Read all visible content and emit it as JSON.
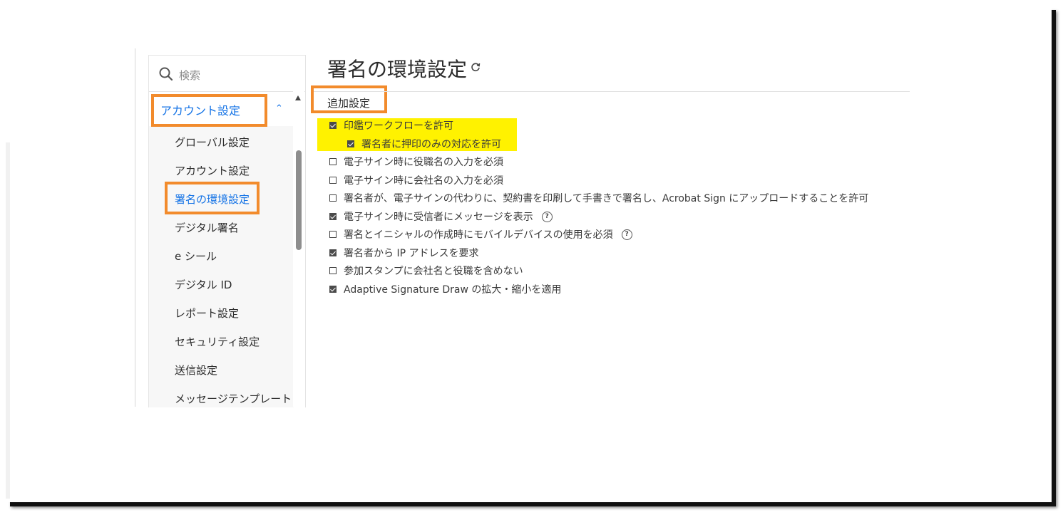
{
  "search": {
    "placeholder": "検索"
  },
  "sidebar": {
    "header_label": "アカウント設定",
    "items": [
      {
        "label": "グローバル設定"
      },
      {
        "label": "アカウント設定"
      },
      {
        "label": "署名の環境設定"
      },
      {
        "label": "デジタル署名"
      },
      {
        "label": "e シール"
      },
      {
        "label": "デジタル ID"
      },
      {
        "label": "レポート設定"
      },
      {
        "label": "セキュリティ設定"
      },
      {
        "label": "送信設定"
      },
      {
        "label": "メッセージテンプレート"
      }
    ],
    "active_index": 2
  },
  "main": {
    "title": "署名の環境設定",
    "section_title": "追加設定",
    "options": [
      {
        "label": "印鑑ワークフローを許可",
        "checked": true
      },
      {
        "label": "署名者に押印のみの対応を許可",
        "checked": true
      },
      {
        "label": "電子サイン時に役職名の入力を必須",
        "checked": false
      },
      {
        "label": "電子サイン時に会社名の入力を必須",
        "checked": false
      },
      {
        "label": "署名者が、電子サインの代わりに、契約書を印刷して手書きで署名し、Acrobat Sign にアップロードすることを許可",
        "checked": false
      },
      {
        "label": "電子サイン時に受信者にメッセージを表示",
        "checked": true
      },
      {
        "label": "署名とイニシャルの作成時にモバイルデバイスの使用を必須",
        "checked": false
      },
      {
        "label": "署名者から IP アドレスを要求",
        "checked": true
      },
      {
        "label": "参加スタンプに会社名と役職を含めない",
        "checked": false
      },
      {
        "label": "Adaptive Signature Draw の拡大・縮小を適用",
        "checked": true
      }
    ]
  },
  "colors": {
    "accent": "#1473e6",
    "highlight_box": "#f28b2c",
    "highlight_fill": "#fff200"
  }
}
